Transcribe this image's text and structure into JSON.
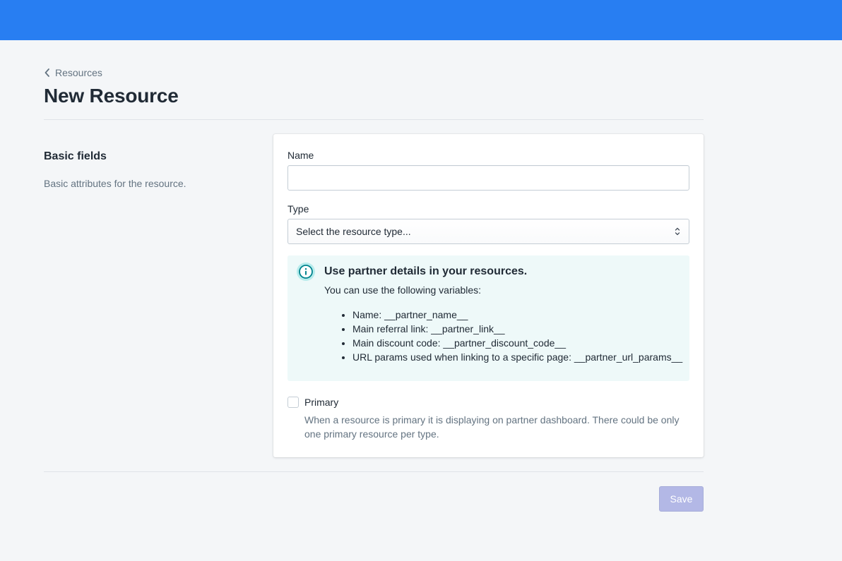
{
  "header": {
    "color": "#287ef2"
  },
  "breadcrumb": {
    "label": "Resources",
    "icon": "chevron-left-icon"
  },
  "page": {
    "title": "New Resource"
  },
  "section": {
    "title": "Basic fields",
    "description": "Basic attributes for the resource."
  },
  "form": {
    "name": {
      "label": "Name",
      "value": "",
      "placeholder": ""
    },
    "type": {
      "label": "Type",
      "selected": "Select the resource type...",
      "icon": "select-arrows-icon"
    },
    "banner": {
      "icon": "info-icon",
      "title": "Use partner details in your resources.",
      "text": "You can use the following variables:",
      "items": [
        "Name: __partner_name__",
        "Main referral link: __partner_link__",
        "Main discount code: __partner_discount_code__",
        "URL params used when linking to a specific page: __partner_url_params__"
      ]
    },
    "primary": {
      "label": "Primary",
      "checked": false,
      "help": "When a resource is primary it is displaying on partner dashboard. There could be only one primary resource per type."
    }
  },
  "actions": {
    "save_label": "Save"
  }
}
